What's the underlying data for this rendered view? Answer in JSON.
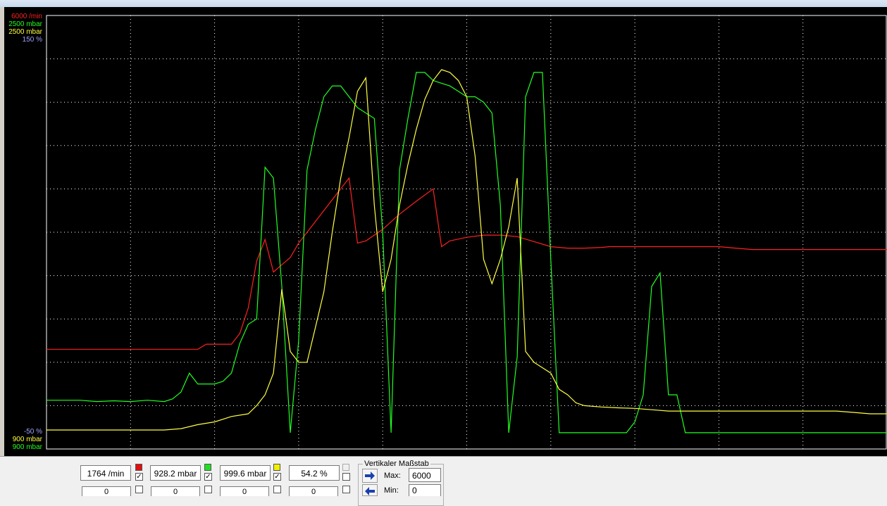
{
  "chart_data": {
    "type": "line",
    "axis_labels_top": [
      {
        "text": "6000 /min",
        "color": "#ff2020"
      },
      {
        "text": "2500 mbar",
        "color": "#20ff20"
      },
      {
        "text": "2500 mbar",
        "color": "#ffff40"
      },
      {
        "text": "150 %",
        "color": "#a0a0ff"
      }
    ],
    "axis_labels_bottom": [
      {
        "text": "-50 %",
        "color": "#a0a0ff"
      },
      {
        "text": "900 mbar",
        "color": "#ffff40"
      },
      {
        "text": "900 mbar",
        "color": "#20ff20"
      }
    ],
    "grid": true,
    "series": [
      {
        "color": "#ff2020",
        "ylim": [
          0,
          6000
        ],
        "points": [
          [
            0,
            1380
          ],
          [
            18,
            1380
          ],
          [
            19,
            1450
          ],
          [
            20,
            1450
          ],
          [
            22,
            1450
          ],
          [
            23,
            1600
          ],
          [
            24,
            1950
          ],
          [
            25,
            2600
          ],
          [
            26,
            2900
          ],
          [
            27,
            2450
          ],
          [
            28,
            2550
          ],
          [
            29,
            2650
          ],
          [
            30,
            2850
          ],
          [
            32,
            3150
          ],
          [
            34,
            3450
          ],
          [
            36,
            3750
          ],
          [
            37,
            2850
          ],
          [
            38,
            2880
          ],
          [
            40,
            3040
          ],
          [
            42,
            3250
          ],
          [
            44,
            3430
          ],
          [
            46,
            3600
          ],
          [
            47,
            2800
          ],
          [
            48,
            2880
          ],
          [
            50,
            2930
          ],
          [
            52,
            2960
          ],
          [
            54,
            2960
          ],
          [
            56,
            2940
          ],
          [
            58,
            2870
          ],
          [
            60,
            2800
          ],
          [
            62,
            2780
          ],
          [
            64,
            2780
          ],
          [
            66,
            2790
          ],
          [
            67,
            2800
          ],
          [
            68,
            2800
          ],
          [
            70,
            2800
          ],
          [
            72,
            2800
          ],
          [
            74,
            2800
          ],
          [
            76,
            2800
          ],
          [
            78,
            2800
          ],
          [
            80,
            2800
          ],
          [
            82,
            2780
          ],
          [
            84,
            2760
          ],
          [
            86,
            2760
          ],
          [
            88,
            2760
          ],
          [
            90,
            2760
          ],
          [
            92,
            2760
          ],
          [
            94,
            2760
          ],
          [
            96,
            2760
          ],
          [
            98,
            2760
          ],
          [
            100,
            2760
          ]
        ]
      },
      {
        "color": "#20ff20",
        "ylim": [
          900,
          2500
        ],
        "points": [
          [
            0,
            1080
          ],
          [
            4,
            1080
          ],
          [
            6,
            1075
          ],
          [
            8,
            1078
          ],
          [
            10,
            1075
          ],
          [
            12,
            1080
          ],
          [
            14,
            1075
          ],
          [
            15,
            1085
          ],
          [
            16,
            1110
          ],
          [
            17,
            1180
          ],
          [
            18,
            1140
          ],
          [
            20,
            1140
          ],
          [
            21,
            1150
          ],
          [
            22,
            1180
          ],
          [
            23,
            1290
          ],
          [
            24,
            1360
          ],
          [
            25,
            1380
          ],
          [
            26,
            1940
          ],
          [
            27,
            1900
          ],
          [
            28,
            1500
          ],
          [
            29,
            960
          ],
          [
            30,
            1300
          ],
          [
            31,
            1930
          ],
          [
            32,
            2080
          ],
          [
            33,
            2200
          ],
          [
            34,
            2240
          ],
          [
            35,
            2240
          ],
          [
            36,
            2200
          ],
          [
            37,
            2160
          ],
          [
            38,
            2140
          ],
          [
            39,
            2120
          ],
          [
            40,
            1700
          ],
          [
            41,
            960
          ],
          [
            42,
            1930
          ],
          [
            43,
            2120
          ],
          [
            44,
            2290
          ],
          [
            45,
            2290
          ],
          [
            46,
            2260
          ],
          [
            47,
            2250
          ],
          [
            48,
            2240
          ],
          [
            49,
            2220
          ],
          [
            50,
            2200
          ],
          [
            51,
            2200
          ],
          [
            52,
            2180
          ],
          [
            53,
            2140
          ],
          [
            54,
            1800
          ],
          [
            55,
            960
          ],
          [
            56,
            1240
          ],
          [
            57,
            2200
          ],
          [
            58,
            2290
          ],
          [
            59,
            2290
          ],
          [
            60,
            1600
          ],
          [
            61,
            960
          ],
          [
            62,
            960
          ],
          [
            64,
            960
          ],
          [
            66,
            960
          ],
          [
            68,
            960
          ],
          [
            69,
            960
          ],
          [
            70,
            1000
          ],
          [
            71,
            1100
          ],
          [
            72,
            1500
          ],
          [
            73,
            1550
          ],
          [
            74,
            1100
          ],
          [
            75,
            1100
          ],
          [
            76,
            960
          ],
          [
            78,
            960
          ],
          [
            80,
            960
          ],
          [
            84,
            960
          ],
          [
            88,
            960
          ],
          [
            92,
            960
          ],
          [
            96,
            960
          ],
          [
            100,
            960
          ]
        ]
      },
      {
        "color": "#ffff40",
        "ylim": [
          900,
          2500
        ],
        "points": [
          [
            0,
            970
          ],
          [
            10,
            970
          ],
          [
            14,
            970
          ],
          [
            16,
            975
          ],
          [
            18,
            990
          ],
          [
            20,
            1000
          ],
          [
            22,
            1020
          ],
          [
            24,
            1030
          ],
          [
            25,
            1060
          ],
          [
            26,
            1100
          ],
          [
            27,
            1180
          ],
          [
            28,
            1490
          ],
          [
            29,
            1260
          ],
          [
            30,
            1220
          ],
          [
            31,
            1220
          ],
          [
            32,
            1350
          ],
          [
            33,
            1480
          ],
          [
            34,
            1700
          ],
          [
            35,
            1900
          ],
          [
            36,
            2050
          ],
          [
            37,
            2220
          ],
          [
            38,
            2270
          ],
          [
            39,
            1800
          ],
          [
            40,
            1480
          ],
          [
            41,
            1600
          ],
          [
            42,
            1800
          ],
          [
            43,
            1950
          ],
          [
            44,
            2080
          ],
          [
            45,
            2190
          ],
          [
            46,
            2260
          ],
          [
            47,
            2300
          ],
          [
            48,
            2290
          ],
          [
            49,
            2260
          ],
          [
            50,
            2200
          ],
          [
            51,
            1980
          ],
          [
            52,
            1600
          ],
          [
            53,
            1510
          ],
          [
            54,
            1600
          ],
          [
            55,
            1720
          ],
          [
            56,
            1900
          ],
          [
            57,
            1260
          ],
          [
            58,
            1220
          ],
          [
            59,
            1200
          ],
          [
            60,
            1180
          ],
          [
            61,
            1120
          ],
          [
            62,
            1100
          ],
          [
            63,
            1070
          ],
          [
            64,
            1060
          ],
          [
            66,
            1055
          ],
          [
            68,
            1052
          ],
          [
            70,
            1050
          ],
          [
            72,
            1045
          ],
          [
            74,
            1040
          ],
          [
            76,
            1040
          ],
          [
            78,
            1040
          ],
          [
            80,
            1040
          ],
          [
            82,
            1040
          ],
          [
            84,
            1040
          ],
          [
            86,
            1040
          ],
          [
            88,
            1040
          ],
          [
            90,
            1040
          ],
          [
            92,
            1040
          ],
          [
            94,
            1040
          ],
          [
            96,
            1035
          ],
          [
            98,
            1030
          ],
          [
            100,
            1030
          ]
        ]
      }
    ]
  },
  "panel": {
    "fields": [
      {
        "value": "1764 /min",
        "swatch": "#e01010",
        "checked": true,
        "min": "0"
      },
      {
        "value": "928.2 mbar",
        "swatch": "#20e020",
        "checked": true,
        "min": "0"
      },
      {
        "value": "999.6 mbar",
        "swatch": "#f0f000",
        "checked": true,
        "min": "0"
      },
      {
        "value": "54.2 %",
        "swatch": "",
        "checked": false,
        "min": "0"
      }
    ],
    "scale_group_title": "Vertikaler Maßstab",
    "max_label": "Max:",
    "max_value": "6000",
    "min_label": "Min:",
    "min_value": "0"
  }
}
